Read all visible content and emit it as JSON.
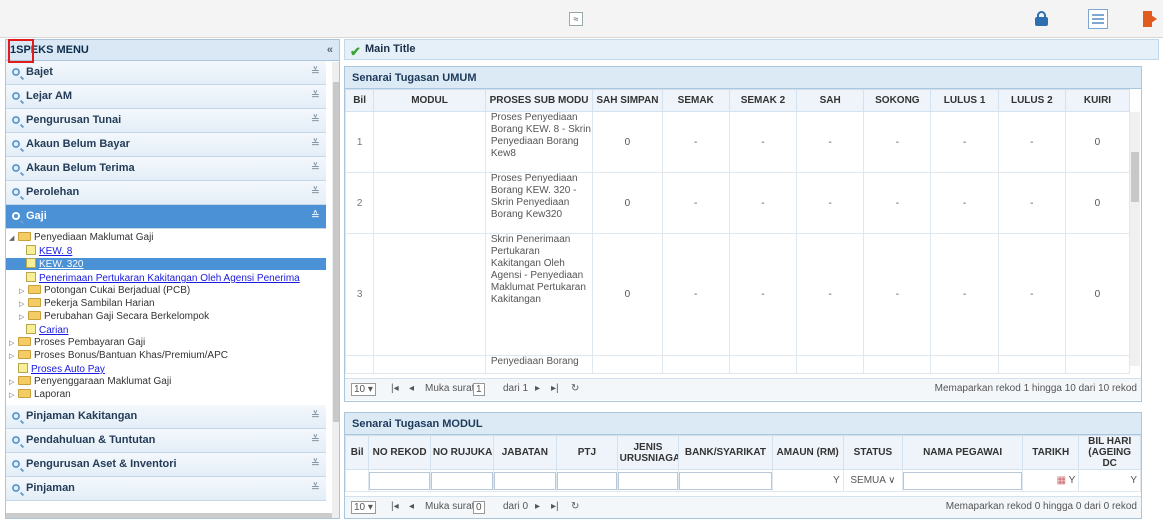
{
  "app": {
    "collapse_label": "≈"
  },
  "left": {
    "header": "1SPEKS MENU",
    "collapse_icon": "«",
    "sections_top": [
      "Bajet",
      "Lejar AM",
      "Pengurusan Tunai",
      "Akaun Belum Bayar",
      "Akaun Belum Terima",
      "Perolehan",
      "Gaji"
    ],
    "sections_bottom": [
      "Pinjaman Kakitangan",
      "Pendahuluan & Tuntutan",
      "Pengurusan Aset & Inventori",
      "Pinjaman"
    ],
    "tree": {
      "n0": "Penyediaan Maklumat Gaji",
      "n1": "KEW. 8",
      "n2": "KEW. 320",
      "n3": "Penerimaan Pertukaran Kakitangan Oleh Agensi Penerima",
      "n4": "Potongan Cukai Berjadual (PCB)",
      "n5": "Pekerja Sambilan Harian",
      "n6": "Perubahan Gaji Secara Berkelompok",
      "n7": "Carian",
      "n8": "Proses Pembayaran Gaji",
      "n9": "Proses Bonus/Bantuan Khas/Premium/APC",
      "n10": "Proses Auto Pay",
      "n11": "Penyenggaraan Maklumat Gaji",
      "n12": "Laporan"
    }
  },
  "main": {
    "title": "Main Title",
    "umum": {
      "title": "Senarai Tugasan UMUM",
      "cols": [
        "Bil",
        "MODUL",
        "PROSES SUB MODU",
        "SAH SIMPAN",
        "SEMAK",
        "SEMAK 2",
        "SAH",
        "SOKONG",
        "LULUS 1",
        "LULUS 2",
        "KUIRI"
      ],
      "rows": [
        {
          "bil": "1",
          "modul": "",
          "proses": "Proses Penyediaan Borang KEW. 8 - Skrin Penyediaan Borang Kew8",
          "sah_simpan": "0",
          "semak": "-",
          "semak2": "-",
          "sah": "-",
          "sokong": "-",
          "lulus1": "-",
          "lulus2": "-",
          "kuiri": "0"
        },
        {
          "bil": "2",
          "modul": "",
          "proses": "Proses Penyediaan Borang KEW. 320 - Skrin Penyediaan Borang Kew320",
          "sah_simpan": "0",
          "semak": "-",
          "semak2": "-",
          "sah": "-",
          "sokong": "-",
          "lulus1": "-",
          "lulus2": "-",
          "kuiri": "0"
        },
        {
          "bil": "3",
          "modul": "",
          "proses": "Skrin Penerimaan Pertukaran Kakitangan Oleh Agensi - Penyediaan Maklumat Pertukaran Kakitangan",
          "sah_simpan": "0",
          "semak": "-",
          "semak2": "-",
          "sah": "-",
          "sokong": "-",
          "lulus1": "-",
          "lulus2": "-",
          "kuiri": "0"
        },
        {
          "bil": "",
          "modul": "",
          "proses": "Penyediaan Borang",
          "sah_simpan": "",
          "semak": "",
          "semak2": "",
          "sah": "",
          "sokong": "",
          "lulus1": "",
          "lulus2": "",
          "kuiri": ""
        }
      ],
      "pager": {
        "size": "10",
        "page_label": "Muka surat",
        "page": "1",
        "of_label": "dari 1",
        "info": "Memaparkan rekod 1 hingga 10 dari 10 rekod"
      }
    },
    "modul": {
      "title": "Senarai Tugasan MODUL",
      "cols": [
        "Bil",
        "NO REKOD",
        "NO RUJUKAN",
        "JABATAN",
        "PTJ",
        "JENIS URUSNIAGA",
        "BANK/SYARIKAT",
        "AMAUN (RM)",
        "STATUS",
        "NAMA PEGAWAI",
        "TARIKH",
        "BIL HARI (AGEING DC"
      ],
      "status_value": "SEMUA",
      "pager": {
        "size": "10",
        "page_label": "Muka surat",
        "page": "0",
        "of_label": "dari 0",
        "info": "Memaparkan rekod 0 hingga 0 dari 0 rekod"
      }
    }
  }
}
